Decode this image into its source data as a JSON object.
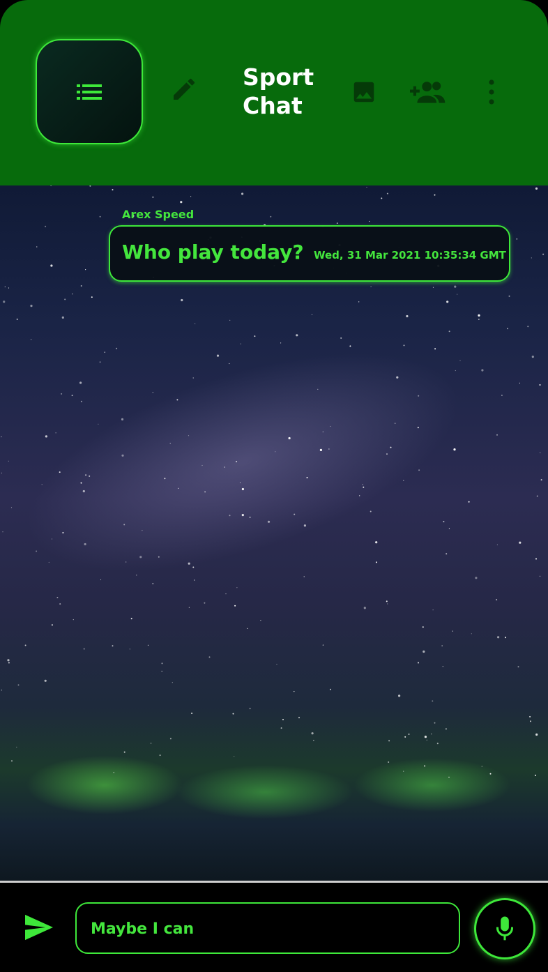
{
  "header": {
    "title": "Sport Chat",
    "background_color": "#076b0c",
    "icons": [
      "list-icon",
      "edit-icon",
      "image-icon",
      "add-group-icon",
      "more-vertical-icon"
    ]
  },
  "chat": {
    "messages": [
      {
        "sender": "Arex Speed",
        "text": "Who play today?",
        "timestamp": "Wed, 31 Mar 2021 10:35:34 GMT"
      }
    ]
  },
  "composer": {
    "input_value": "Maybe I can",
    "send_icon": "send-icon",
    "mic_icon": "mic-icon"
  },
  "colors": {
    "accent": "#3ee83a",
    "text_accent": "#44e63d",
    "header": "#076b0c"
  }
}
